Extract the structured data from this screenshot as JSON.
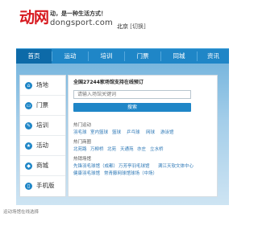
{
  "header": {
    "logo_text": "动网",
    "slogan": "动，是一种生活方式！",
    "domain": "dongsport.com",
    "city": "北京",
    "city_switch": "[切换]"
  },
  "nav": {
    "items": [
      {
        "label": "首页",
        "active": true
      },
      {
        "label": "运动",
        "active": false
      },
      {
        "label": "培训",
        "active": false
      },
      {
        "label": "门票",
        "active": false
      },
      {
        "label": "同城",
        "active": false
      },
      {
        "label": "资讯",
        "active": false
      }
    ]
  },
  "sidebar": {
    "items": [
      {
        "label": "场地",
        "icon": "venue-icon"
      },
      {
        "label": "门票",
        "icon": "ticket-icon"
      },
      {
        "label": "培训",
        "icon": "training-icon"
      },
      {
        "label": "活动",
        "icon": "activity-icon"
      },
      {
        "label": "商城",
        "icon": "mall-icon"
      },
      {
        "label": "手机版",
        "icon": "mobile-icon"
      }
    ]
  },
  "panel": {
    "title": "全国27244家场馆支持在线预订",
    "search_placeholder": "请输入场馆关键词",
    "search_button": "搜索",
    "hot_sports": {
      "title": "热门运动",
      "links": [
        "羽毛球",
        "室内篮球",
        "篮球",
        "乒乓球",
        "网球",
        "游泳馆"
      ]
    },
    "hot_areas": {
      "title": "热门商圈",
      "links": [
        "北苑路",
        "万柳桥",
        "北苑",
        "天通苑",
        "亦庄",
        "立水桥"
      ]
    },
    "hot_venues": {
      "title": "热销场馆",
      "links": [
        "先锋羽毛球馆（成都）",
        "万芳亭羽毛球馆",
        "满江天软文体中心",
        "健康羽毛球馆",
        "常青藤网球馆球场（中场）"
      ]
    }
  },
  "footer": {
    "text": "运动场馆在线选择"
  },
  "colors": {
    "brand_red": "#d7191f",
    "nav_blue": "#1f86c7",
    "nav_active": "#0d6aa8",
    "link_blue": "#2a76b5"
  }
}
